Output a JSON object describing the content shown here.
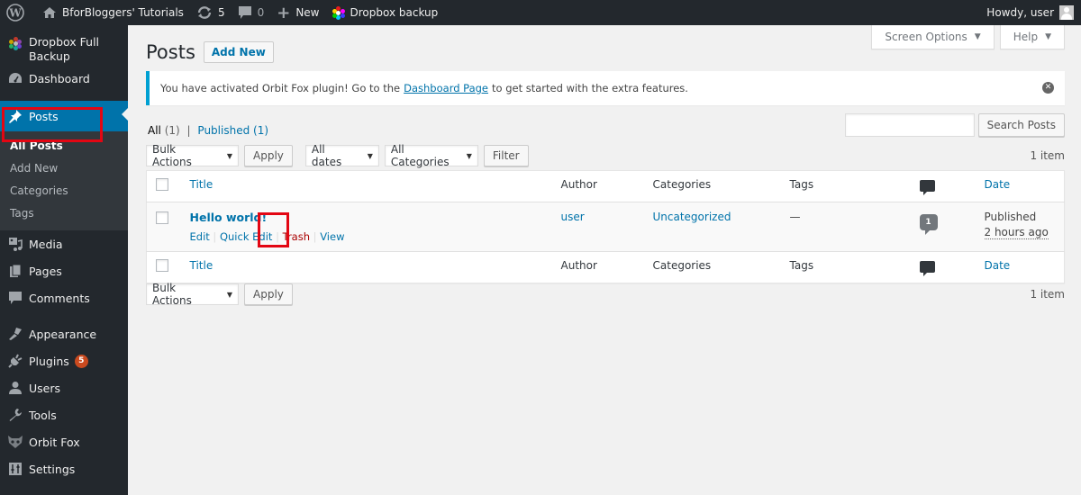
{
  "admin_bar": {
    "site_name": "BforBloggers' Tutorials",
    "updates_count": "5",
    "comments_count": "0",
    "new_label": "New",
    "dropbox_label": "Dropbox backup",
    "howdy": "Howdy, user"
  },
  "sidebar": {
    "items": [
      {
        "label": "Dropbox Full Backup",
        "icon": "dropbox-flower-icon"
      },
      {
        "label": "Dashboard",
        "icon": "dashboard-icon"
      },
      {
        "label": "Posts",
        "icon": "pin-icon",
        "current": true
      },
      {
        "label": "Media",
        "icon": "media-icon"
      },
      {
        "label": "Pages",
        "icon": "pages-icon"
      },
      {
        "label": "Comments",
        "icon": "comment-icon"
      },
      {
        "label": "Appearance",
        "icon": "paintbrush-icon"
      },
      {
        "label": "Plugins",
        "icon": "plug-icon",
        "badge": "5"
      },
      {
        "label": "Users",
        "icon": "user-icon"
      },
      {
        "label": "Tools",
        "icon": "wrench-icon"
      },
      {
        "label": "Orbit Fox",
        "icon": "fox-icon"
      },
      {
        "label": "Settings",
        "icon": "settings-icon"
      }
    ],
    "posts_submenu": [
      "All Posts",
      "Add New",
      "Categories",
      "Tags"
    ]
  },
  "screen_meta": {
    "screen_options": "Screen Options",
    "help": "Help"
  },
  "page": {
    "title": "Posts",
    "add_new": "Add New"
  },
  "notice": {
    "text_before": "You have activated Orbit Fox plugin! Go to the",
    "link": "Dashboard Page",
    "text_after": "to get started with the extra features."
  },
  "views": {
    "all": "All",
    "all_count": "(1)",
    "separator": "|",
    "published": "Published",
    "published_count": "(1)"
  },
  "search": {
    "value": "",
    "button": "Search Posts"
  },
  "tablenav_top": {
    "bulk_actions": "Bulk Actions",
    "apply": "Apply",
    "dates": "All dates",
    "categories": "All Categories",
    "filter": "Filter",
    "items": "1 item"
  },
  "tablenav_bottom": {
    "bulk_actions": "Bulk Actions",
    "apply": "Apply",
    "items": "1 item"
  },
  "table": {
    "columns": {
      "title": "Title",
      "author": "Author",
      "categories": "Categories",
      "tags": "Tags",
      "comments_icon": "comment-icon",
      "date": "Date"
    },
    "rows": [
      {
        "title": "Hello world!",
        "actions": {
          "edit": "Edit",
          "quick_edit": "Quick Edit",
          "trash": "Trash",
          "view": "View"
        },
        "author": "user",
        "categories": "Uncategorized",
        "tags": "—",
        "comments": "1",
        "status": "Published",
        "date": "2 hours ago"
      }
    ]
  }
}
